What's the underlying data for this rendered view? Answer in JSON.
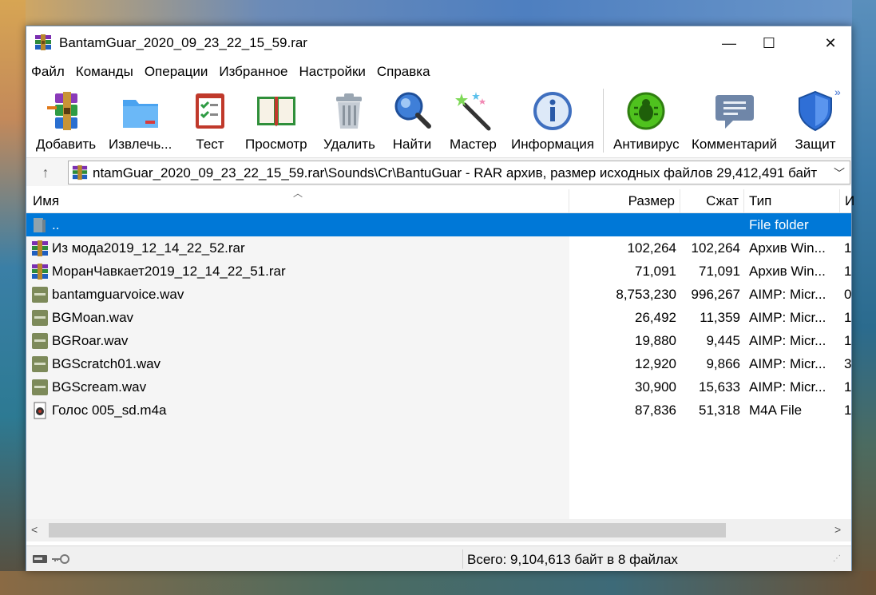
{
  "window": {
    "title": "BantamGuar_2020_09_23_22_15_59.rar",
    "minimize_glyph": "—",
    "maximize_glyph": "☐",
    "close_glyph": "✕"
  },
  "menu": [
    "Файл",
    "Команды",
    "Операции",
    "Избранное",
    "Настройки",
    "Справка"
  ],
  "toolbar": {
    "buttons": [
      {
        "label": "Добавить",
        "icon": "winrar-add-icon"
      },
      {
        "label": "Извлечь...",
        "icon": "folder-extract-icon"
      },
      {
        "label": "Тест",
        "icon": "test-checklist-icon"
      },
      {
        "label": "Просмотр",
        "icon": "book-view-icon"
      },
      {
        "label": "Удалить",
        "icon": "trash-icon"
      },
      {
        "label": "Найти",
        "icon": "magnifier-icon"
      },
      {
        "label": "Мастер",
        "icon": "magic-wand-icon"
      },
      {
        "label": "Информация",
        "icon": "info-icon"
      },
      {
        "label": "Антивирус",
        "icon": "antivirus-bug-icon"
      },
      {
        "label": "Комментарий",
        "icon": "comment-icon"
      },
      {
        "label": "Защит",
        "icon": "shield-icon"
      }
    ],
    "more_glyph": "»"
  },
  "address": {
    "path": "ntamGuar_2020_09_23_22_15_59.rar\\Sounds\\Cr\\BantuGuar - RAR архив, размер исходных файлов 29,412,491 байт",
    "up_glyph": "↑",
    "dropdown_glyph": "﹀"
  },
  "columns": {
    "name": "Имя",
    "size": "Размер",
    "packed": "Сжат",
    "type": "Тип",
    "extra": "И"
  },
  "files": [
    {
      "name": "..",
      "size": "",
      "packed": "",
      "type": "File folder",
      "extra": "",
      "icon": "folder-up-icon",
      "selected": true
    },
    {
      "name": "Из мода2019_12_14_22_52.rar",
      "size": "102,264",
      "packed": "102,264",
      "type": "Архив Win...",
      "extra": "1",
      "icon": "rar-file-icon"
    },
    {
      "name": "МоранЧавкает2019_12_14_22_51.rar",
      "size": "71,091",
      "packed": "71,091",
      "type": "Архив Win...",
      "extra": "1",
      "icon": "rar-file-icon"
    },
    {
      "name": "bantamguarvoice.wav",
      "size": "8,753,230",
      "packed": "996,267",
      "type": "AIMP: Micr...",
      "extra": "0",
      "icon": "wav-file-icon"
    },
    {
      "name": "BGMoan.wav",
      "size": "26,492",
      "packed": "11,359",
      "type": "AIMP: Micr...",
      "extra": "1",
      "icon": "wav-file-icon"
    },
    {
      "name": "BGRoar.wav",
      "size": "19,880",
      "packed": "9,445",
      "type": "AIMP: Micr...",
      "extra": "1",
      "icon": "wav-file-icon"
    },
    {
      "name": "BGScratch01.wav",
      "size": "12,920",
      "packed": "9,866",
      "type": "AIMP: Micr...",
      "extra": "3",
      "icon": "wav-file-icon"
    },
    {
      "name": "BGScream.wav",
      "size": "30,900",
      "packed": "15,633",
      "type": "AIMP: Micr...",
      "extra": "1",
      "icon": "wav-file-icon"
    },
    {
      "name": "Голос 005_sd.m4a",
      "size": "87,836",
      "packed": "51,318",
      "type": "M4A File",
      "extra": "1",
      "icon": "m4a-file-icon"
    }
  ],
  "scroll": {
    "left_glyph": "<",
    "right_glyph": ">"
  },
  "status": {
    "summary": "Всего: 9,104,613 байт в 8 файлах"
  },
  "colors": {
    "selection": "#0078d7",
    "accent": "#0078d7"
  }
}
